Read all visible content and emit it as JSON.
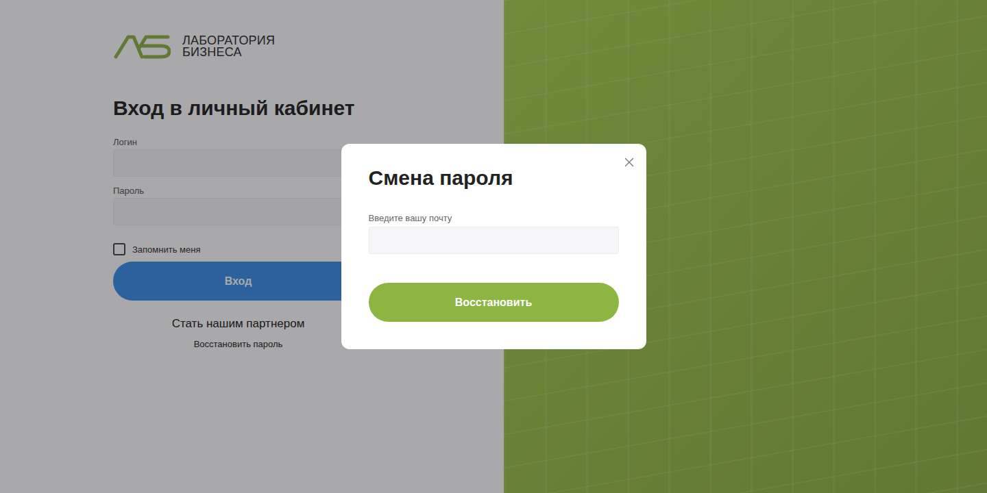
{
  "logo": {
    "lines": [
      "ЛАБОРАТОРИЯ",
      "БИЗНЕСА"
    ]
  },
  "login": {
    "title": "Вход в личный кабинет",
    "fields": [
      {
        "label": "Логин",
        "value": ""
      },
      {
        "label": "Пароль",
        "value": ""
      }
    ],
    "remember": {
      "label": "Запомнить меня",
      "checked": false
    },
    "submit": "Вход",
    "partner_link": "Стать нашим партнером",
    "restore_link": "Восстановить пароль"
  },
  "modal": {
    "title": "Смена пароля",
    "field": {
      "label": "Введите вашу почту",
      "value": ""
    },
    "submit": "Восстановить"
  }
}
